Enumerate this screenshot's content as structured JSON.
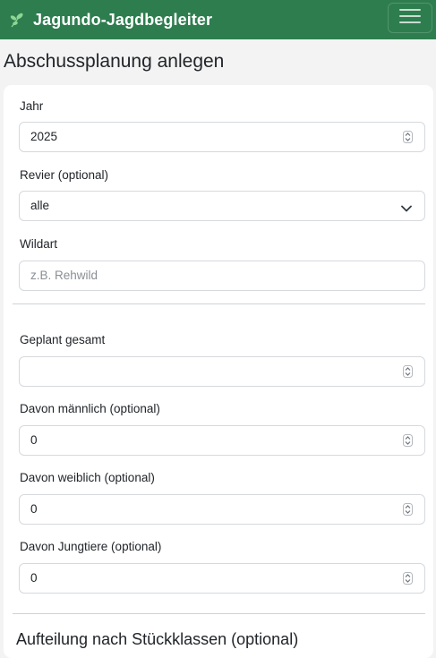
{
  "app": {
    "brand_name": "Jagundo-Jagdbegleiter",
    "brand_icon": "leaf-icon",
    "menu_icon": "hamburger-menu-icon",
    "colors": {
      "navbar": "#2e7d4f",
      "page_background": "#f3f3f3",
      "card_background": "#ffffff",
      "text": "#212529",
      "placeholder": "#8a8f94"
    }
  },
  "page": {
    "title": "Abschussplanung anlegen"
  },
  "form": {
    "year": {
      "label": "Jahr",
      "value": "2025",
      "icon": "spinner-arrows-icon"
    },
    "revier": {
      "label": "Revier (optional)",
      "value": "alle",
      "icon": "chevron-down-icon"
    },
    "wildart": {
      "label": "Wildart",
      "value": "",
      "placeholder": "z.B. Rehwild"
    },
    "planned_total": {
      "label": "Geplant gesamt",
      "value": ""
    },
    "male": {
      "label": "Davon männlich (optional)",
      "value": "0"
    },
    "female": {
      "label": "Davon weiblich (optional)",
      "value": "0"
    },
    "young": {
      "label": "Davon Jungtiere (optional)",
      "value": "0"
    }
  },
  "section": {
    "classes_heading": "Aufteilung nach Stückklassen (optional)"
  }
}
